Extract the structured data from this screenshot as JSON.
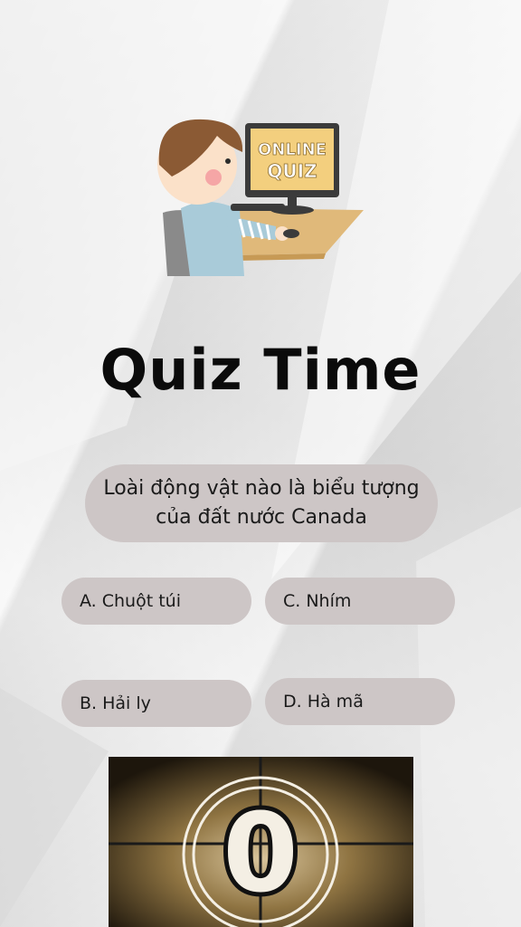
{
  "illustration": {
    "monitor_text_line1": "ONLINE",
    "monitor_text_line2": "QUIZ"
  },
  "title": "Quiz Time",
  "question": "Loài động vật nào là biểu tượng của đất nước Canada",
  "answers": [
    {
      "label": "A. Chuột túi"
    },
    {
      "label": "C. Nhím"
    },
    {
      "label": "B. Hải ly"
    },
    {
      "label": "D. Hà mã"
    }
  ],
  "countdown": {
    "number": "0"
  },
  "colors": {
    "pill": "#cdc6c6",
    "title": "#0b0b0b",
    "monitor_screen": "#f3cf7e"
  }
}
